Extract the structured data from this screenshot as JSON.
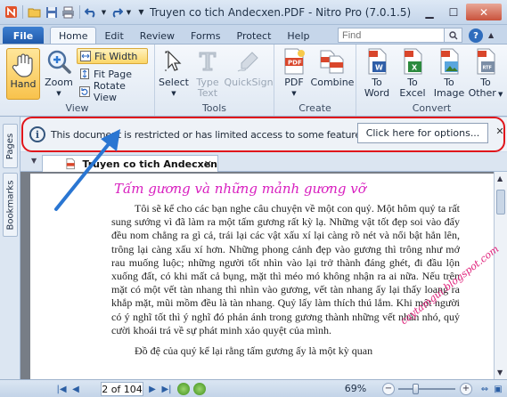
{
  "window": {
    "title": "Truyen co tich Andecxen.PDF - Nitro Pro (7.0.1.5)",
    "buttons": [
      "minimize",
      "maximize",
      "close"
    ]
  },
  "quick_access": [
    "nitro-logo-icon",
    "open-folder-icon",
    "save-icon",
    "print-icon",
    "undo-icon",
    "redo-icon",
    "customize-icon"
  ],
  "tabs": {
    "file_label": "File",
    "items": [
      {
        "label": "Home",
        "active": true
      },
      {
        "label": "Edit"
      },
      {
        "label": "Review"
      },
      {
        "label": "Forms"
      },
      {
        "label": "Protect"
      },
      {
        "label": "Help"
      }
    ]
  },
  "search": {
    "placeholder": "Find"
  },
  "ribbon": {
    "view": {
      "label": "View",
      "hand": "Hand",
      "zoom": "Zoom",
      "fit_width": "Fit Width",
      "fit_page": "Fit Page",
      "rotate_view": "Rotate View"
    },
    "tools": {
      "label": "Tools",
      "select": "Select",
      "type_text_1": "Type",
      "type_text_2": "Text",
      "quicksign": "QuickSign"
    },
    "create": {
      "label": "Create",
      "pdf": "PDF",
      "combine": "Combine"
    },
    "convert": {
      "label": "Convert",
      "to_word_1": "To",
      "to_word_2": "Word",
      "to_excel_1": "To",
      "to_excel_2": "Excel",
      "to_image_1": "To",
      "to_image_2": "Image",
      "to_other_1": "To",
      "to_other_2": "Other"
    }
  },
  "notification": {
    "message": "This document is restricted or has limited access to some features.",
    "options_button": "Click here for options...",
    "close": "✕"
  },
  "sidebar": {
    "pages": "Pages",
    "bookmarks": "Bookmarks"
  },
  "document_tab": {
    "name": "Truyen co tich Andecxen",
    "close": "✕"
  },
  "document": {
    "title": "Tấm gương và những mảnh gương vỡ",
    "paragraph1": "Tôi sẽ kể cho các bạn nghe câu chuyện về một con quỷ. Một hôm quỷ ta rất sung sướng vì đã làm ra một tấm gương rất kỳ lạ. Những vật tốt đẹp soi vào đấy đều nom chẳng ra gì cả, trái lại các vật xấu xí lại càng rõ nét và nổi bật hẳn lên, trông lại càng xấu xí hơn. Những phong cảnh đẹp vào gương thì trông như mớ rau muống luộc; những người tốt nhìn vào lại trở thành đáng ghét, đi đầu lộn xuống đất, có khi mất cả bụng, mặt thì méo mó không nhận ra ai nữa. Nếu trên mặt có một vết tàn nhang thì nhìn vào gương, vết tàn nhang ấy lại thấy loang ra khắp mặt, mũi mồm đều là tàn nhang. Quỷ lấy làm thích thú lắm. Khi một người có ý nghĩ tốt thì ý nghĩ đó phản ánh trong gương thành những vết nhăn nhó, quỷ cười khoái trá về sự phát minh xảo quyệt của mình.",
    "paragraph2": "Đồ đệ của quỷ kể lại rằng tấm gương ấy là một kỳ quan"
  },
  "watermark": "caytamgui.blogspot.com",
  "statusbar": {
    "page_input": "2 of 104",
    "zoom": "69%",
    "zoom_level_fraction": 0.69
  },
  "colors": {
    "accent": "#1e57a8",
    "restriction_outline": "#e0151b",
    "arrow": "#2a76d2",
    "title_text": "#d81fbf"
  }
}
